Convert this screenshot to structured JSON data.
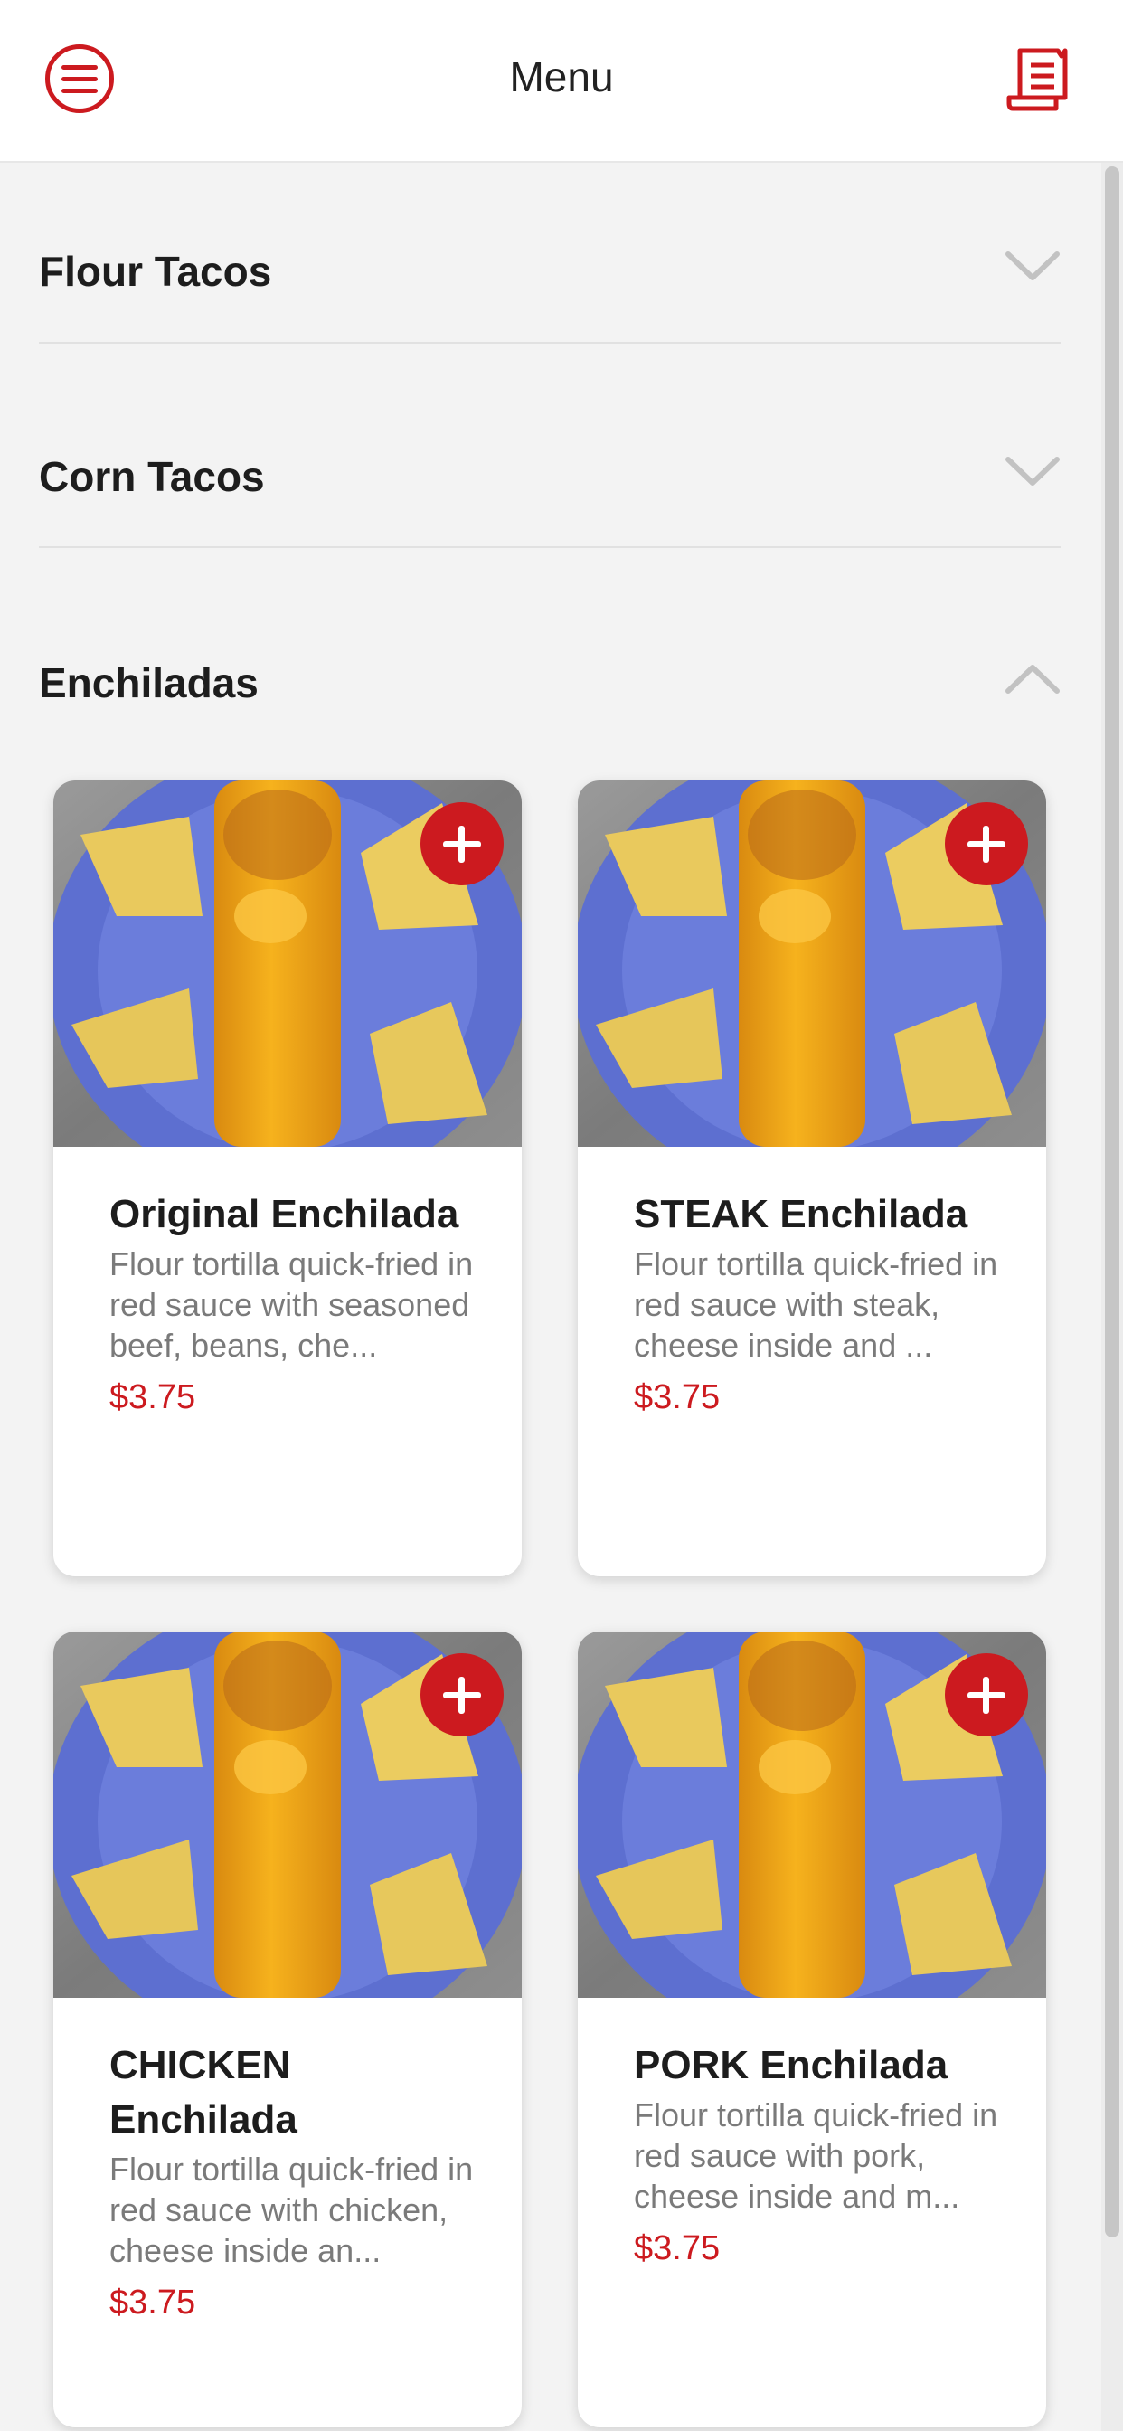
{
  "header": {
    "title": "Menu",
    "menu_icon": "hamburger-menu-icon",
    "order_icon": "receipt-icon"
  },
  "colors": {
    "accent": "#cc1a1f",
    "background": "#f3f3f3",
    "card": "#ffffff"
  },
  "categories": [
    {
      "title": "Flour Tacos",
      "state": "collapsed"
    },
    {
      "title": "Corn Tacos",
      "state": "collapsed"
    },
    {
      "title": "Enchiladas",
      "state": "expanded"
    }
  ],
  "products": [
    {
      "name": "Original Enchilada",
      "description": "Flour tortilla quick-fried in red sauce with seasoned beef, beans, che...",
      "price": "$3.75"
    },
    {
      "name": "STEAK Enchilada",
      "description": "Flour tortilla quick-fried in red sauce with steak, cheese inside and ...",
      "price": "$3.75"
    },
    {
      "name": "CHICKEN Enchilada",
      "description": "Flour tortilla quick-fried in red sauce with chicken, cheese inside an...",
      "price": "$3.75"
    },
    {
      "name": "PORK Enchilada",
      "description": "Flour tortilla quick-fried in red sauce with pork, cheese inside and m...",
      "price": "$3.75"
    }
  ]
}
